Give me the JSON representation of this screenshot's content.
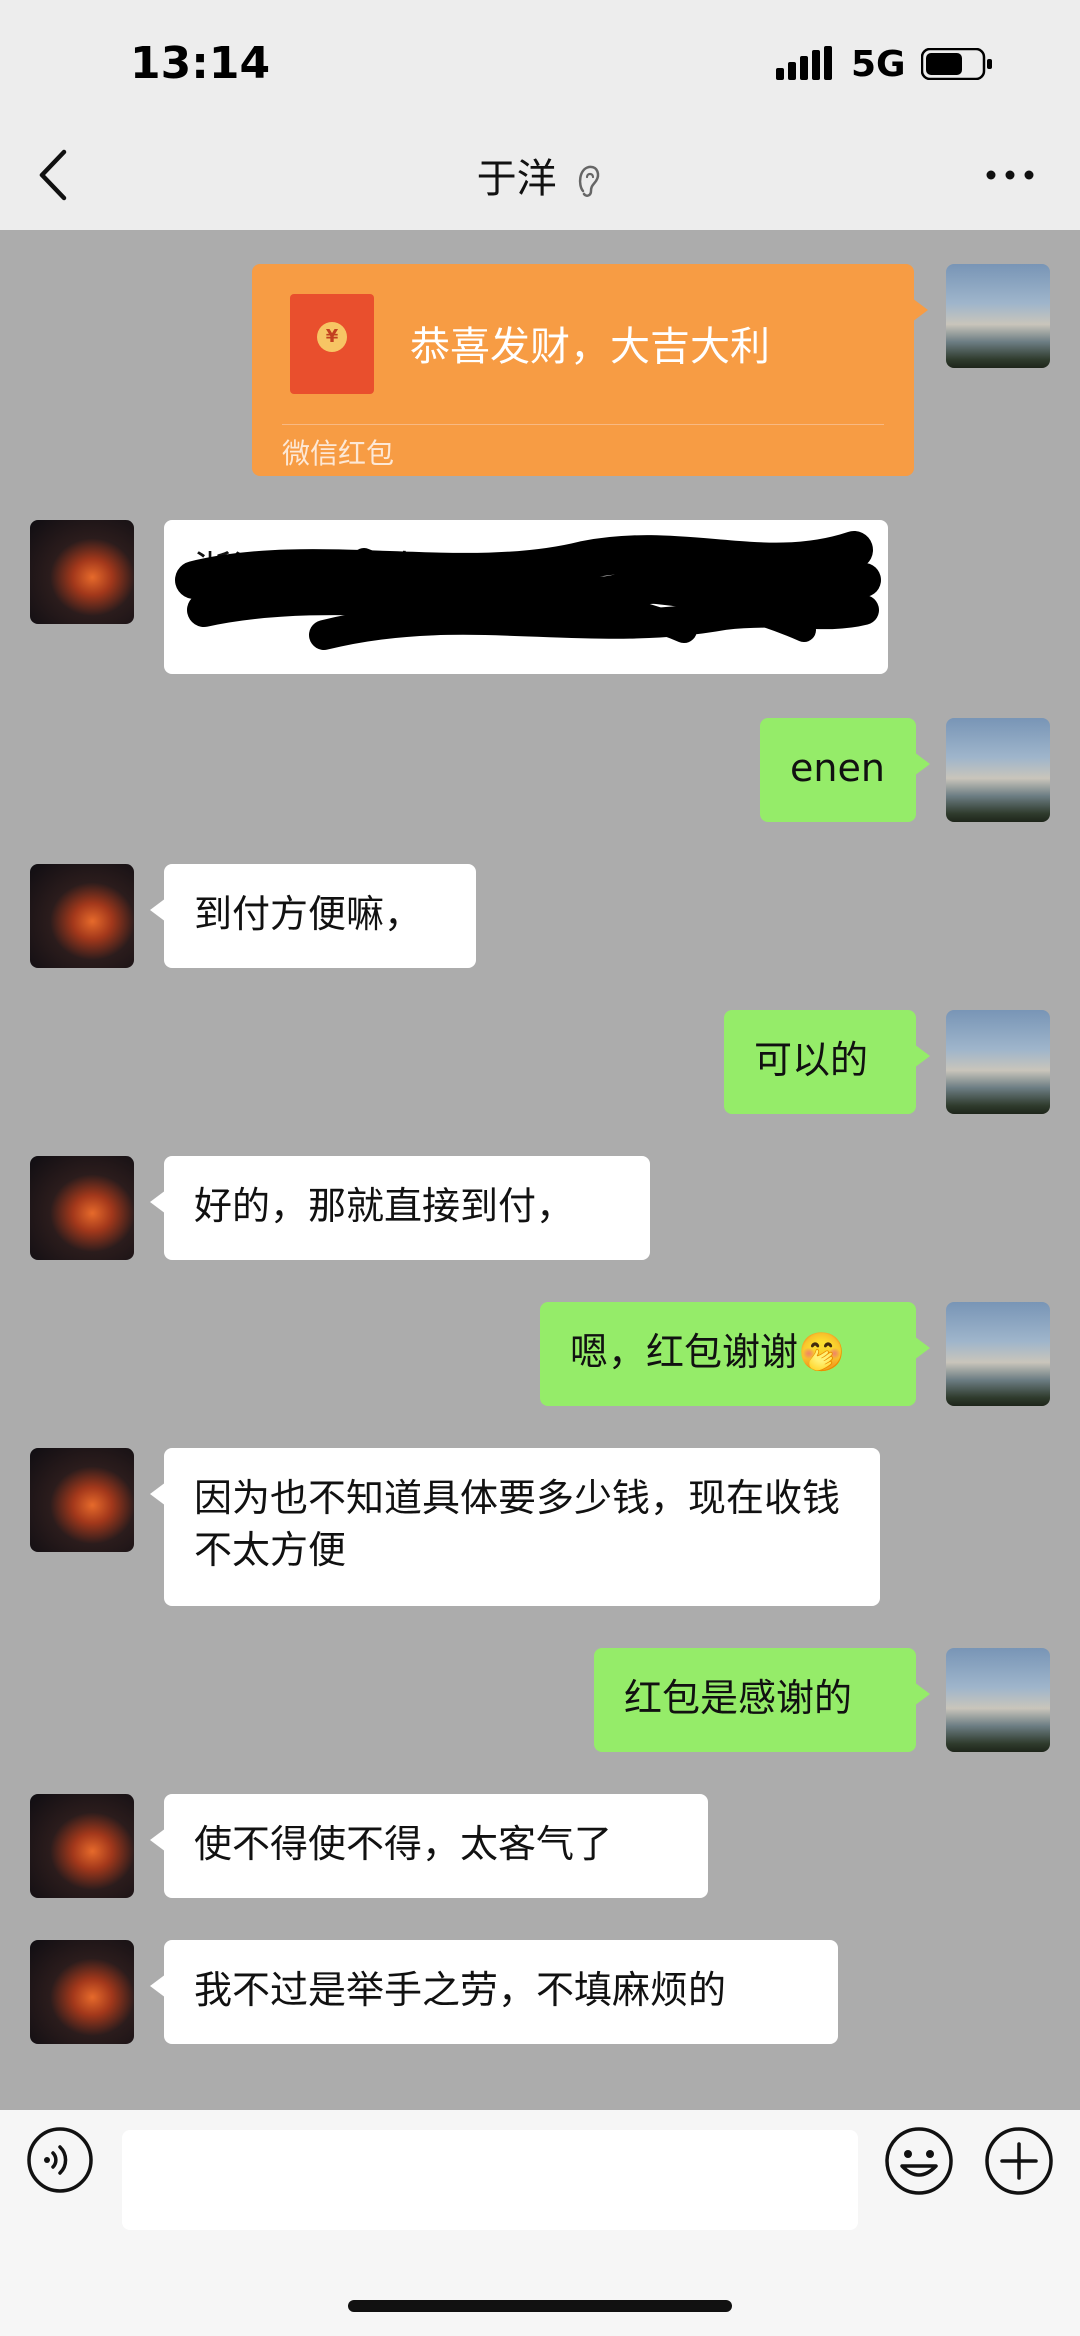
{
  "status_bar": {
    "time": "13:14",
    "network": "5G",
    "icons": [
      "signal-bars-icon",
      "battery-icon"
    ]
  },
  "nav": {
    "title": "于洋",
    "icons": [
      "back-chevron-icon",
      "ear-icon",
      "more-dots-icon"
    ]
  },
  "messages": [
    {
      "side": "right",
      "type": "red-packet",
      "text": "恭喜发财，大吉大利",
      "caption": "微信红包"
    },
    {
      "side": "left",
      "type": "redacted",
      "text": "浙江…… 三好…… 树"
    },
    {
      "side": "right",
      "type": "text",
      "text": "enen"
    },
    {
      "side": "left",
      "type": "text",
      "text": "到付方便嘛，"
    },
    {
      "side": "right",
      "type": "text",
      "text": "可以的"
    },
    {
      "side": "left",
      "type": "text",
      "text": "好的，那就直接到付，"
    },
    {
      "side": "right",
      "type": "text",
      "text": "嗯，红包谢谢🤭"
    },
    {
      "side": "left",
      "type": "text",
      "text": "因为也不知道具体要多少钱，现在收钱不太方便"
    },
    {
      "side": "right",
      "type": "text",
      "text": "红包是感谢的"
    },
    {
      "side": "left",
      "type": "text",
      "text": "使不得使不得，太客气了"
    },
    {
      "side": "left",
      "type": "text",
      "text": "我不过是举手之劳，不填麻烦的"
    }
  ],
  "input_bar": {
    "icons": [
      "voice-icon",
      "emoji-icon",
      "plus-icon"
    ],
    "value": ""
  },
  "colors": {
    "self_bubble": "#95ec69",
    "other_bubble": "#ffffff",
    "chat_bg": "#acacac",
    "red_packet": "#f79c44"
  }
}
